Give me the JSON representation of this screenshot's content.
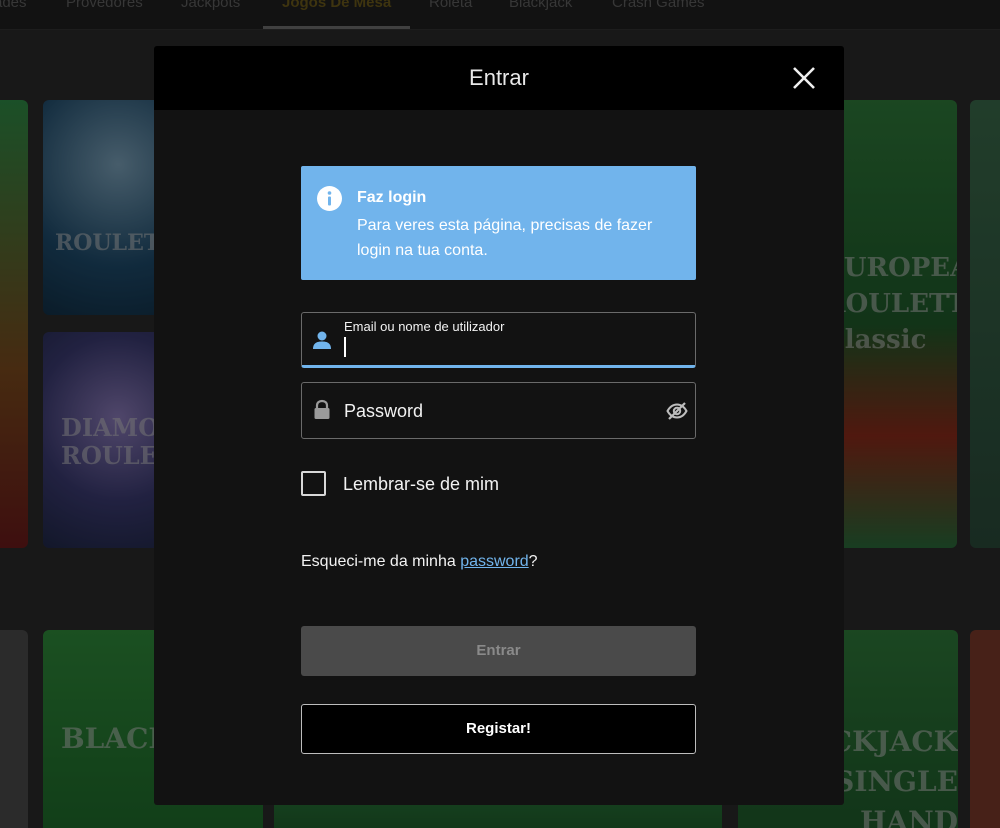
{
  "background": {
    "nav_tabs": [
      {
        "label": "ades"
      },
      {
        "label": "Provedores"
      },
      {
        "label": "Jackpots"
      },
      {
        "label": "Jogos De Mesa"
      },
      {
        "label": "Roleta"
      },
      {
        "label": "Blackjack"
      },
      {
        "label": "Crash Games"
      }
    ],
    "tiles": [
      {
        "caption": "ROULETTE"
      },
      {
        "caption": "DIAMOND ROULETTE"
      },
      {
        "caption": "EUROPEAN ROULETTE Classic"
      },
      {
        "caption": "BLACKJACK"
      },
      {
        "caption": "BLACKJACK SINGLE HAND"
      }
    ]
  },
  "modal": {
    "title": "Entrar",
    "alert": {
      "title": "Faz login",
      "text": "Para veres esta página, precisas de fazer login na tua conta."
    },
    "email_field": {
      "label": "Email ou nome de utilizador",
      "value": ""
    },
    "password_field": {
      "placeholder": "Password"
    },
    "remember_label": "Lembrar-se de mim",
    "forgot_prefix": "Esqueci-me da minha ",
    "forgot_link": "password",
    "forgot_suffix": "?",
    "login_button": "Entrar",
    "register_button": "Registar!"
  },
  "colors": {
    "accent": "#71b4ec",
    "modal_bg": "#121212",
    "header_bg": "#000000",
    "disabled_button": "#4a4a4a"
  }
}
